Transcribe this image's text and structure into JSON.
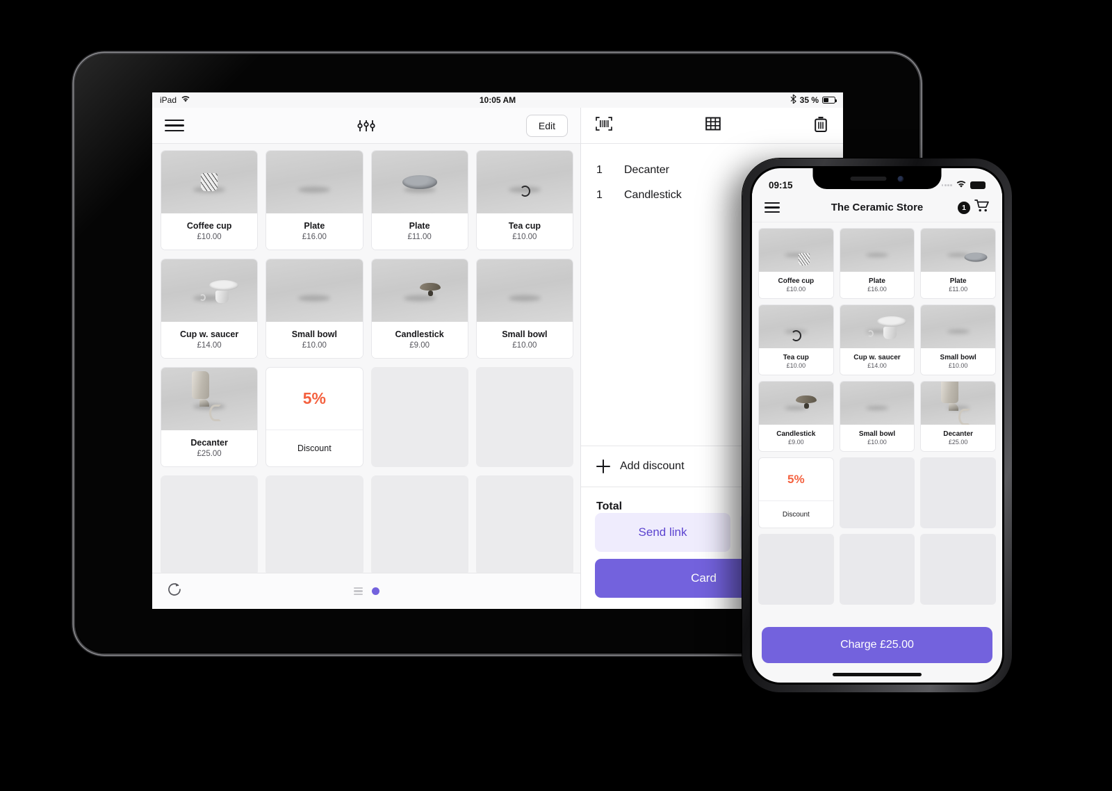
{
  "tablet": {
    "status_bar": {
      "device_label": "iPad",
      "wifi_icon": "wifi-icon",
      "time": "10:05 AM",
      "bluetooth_icon": "bluetooth-icon",
      "battery_percent": "35 %",
      "battery_icon": "battery-icon"
    },
    "catalogue_toolbar": {
      "menu_icon": "hamburger-menu-icon",
      "filter_icon": "sliders-filter-icon",
      "edit_label": "Edit"
    },
    "products": [
      {
        "name": "Coffee cup",
        "price": "£10.00",
        "art": "mug-speckled"
      },
      {
        "name": "Plate",
        "price": "£16.00",
        "art": "plate-spot"
      },
      {
        "name": "Plate",
        "price": "£11.00",
        "art": "plate-grey"
      },
      {
        "name": "Tea cup",
        "price": "£10.00",
        "art": "teacup"
      },
      {
        "name": "Cup w. saucer",
        "price": "£14.00",
        "art": "cupsaucer"
      },
      {
        "name": "Small bowl",
        "price": "£10.00",
        "art": "bowl-tan"
      },
      {
        "name": "Candlestick",
        "price": "£9.00",
        "art": "candlestick"
      },
      {
        "name": "Small bowl",
        "price": "£10.00",
        "art": "bowl-green"
      },
      {
        "name": "Decanter",
        "price": "£25.00",
        "art": "decanter"
      }
    ],
    "discount_tile": {
      "percent": "5%",
      "label": "Discount"
    },
    "empty_tiles": 7,
    "footer": {
      "refresh_icon": "refresh-icon",
      "pager_list_icon": "pager-list-icon",
      "pager_active_dot": "pager-active-dot"
    },
    "cart_toolbar": {
      "barcode_icon": "barcode-scan-icon",
      "grid_icon": "grid-keypad-icon",
      "trash_icon": "trash-delete-icon"
    },
    "cart_lines": [
      {
        "qty": "1",
        "name": "Decanter"
      },
      {
        "qty": "1",
        "name": "Candlestick"
      }
    ],
    "add_discount_label": "Add discount",
    "plus_icon": "plus-icon",
    "total_label": "Total",
    "buttons": {
      "send_link": "Send link",
      "secondary_partial": "",
      "card": "Card"
    }
  },
  "phone": {
    "status_bar": {
      "time": "09:15",
      "signal_icon": "signal-dots-icon",
      "wifi_icon": "wifi-icon",
      "battery_icon": "battery-icon"
    },
    "header": {
      "menu_icon": "hamburger-menu-icon",
      "title": "The Ceramic Store",
      "cart_count": "1",
      "cart_icon": "shopping-cart-icon"
    },
    "products": [
      {
        "name": "Coffee cup",
        "price": "£10.00",
        "art": "mug-speckled"
      },
      {
        "name": "Plate",
        "price": "£16.00",
        "art": "plate-spot"
      },
      {
        "name": "Plate",
        "price": "£11.00",
        "art": "plate-grey"
      },
      {
        "name": "Tea cup",
        "price": "£10.00",
        "art": "teacup"
      },
      {
        "name": "Cup w. saucer",
        "price": "£14.00",
        "art": "cupsaucer"
      },
      {
        "name": "Small bowl",
        "price": "£10.00",
        "art": "bowl-tan"
      },
      {
        "name": "Candlestick",
        "price": "£9.00",
        "art": "candlestick"
      },
      {
        "name": "Small bowl",
        "price": "£10.00",
        "art": "bowl-green"
      },
      {
        "name": "Decanter",
        "price": "£25.00",
        "art": "decanter"
      }
    ],
    "discount_tile": {
      "percent": "5%",
      "label": "Discount"
    },
    "empty_tiles": 5,
    "charge_button": "Charge £25.00",
    "home_indicator": "home-indicator"
  },
  "colors": {
    "accent_purple": "#7362DD",
    "accent_purple_soft_bg": "#EFECFD",
    "accent_purple_soft_text": "#5B43CF",
    "discount_orange": "#F4613F",
    "background": "#000000",
    "screen_bg": "#F7F7F8"
  }
}
